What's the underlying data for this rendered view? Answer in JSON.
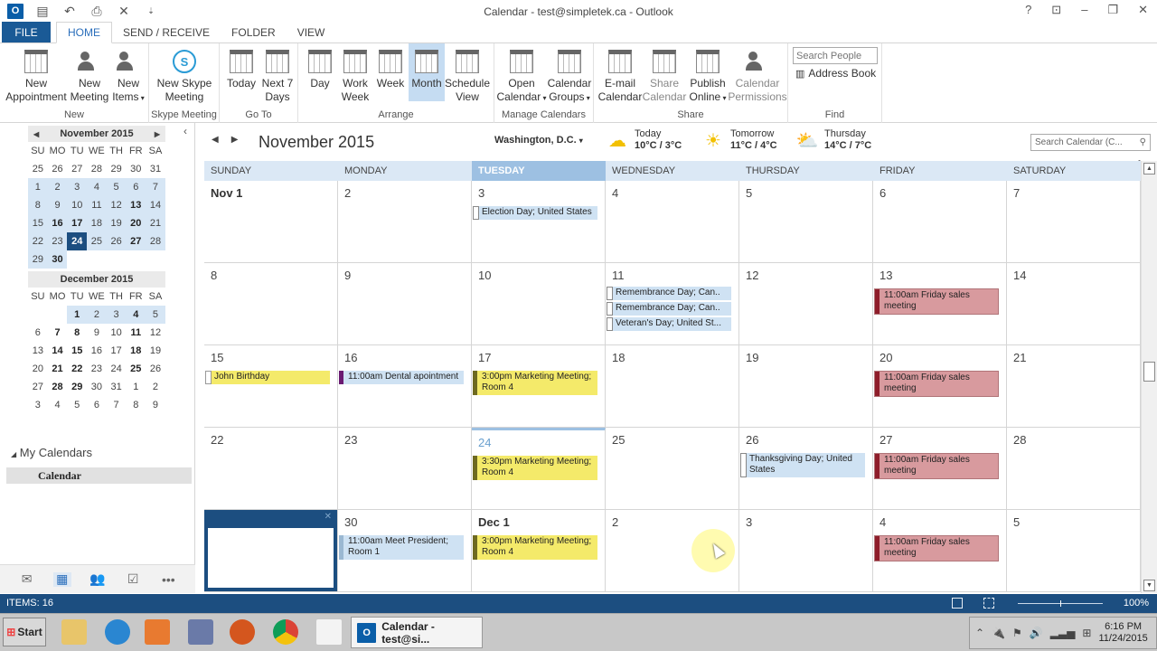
{
  "window": {
    "title": "Calendar - test@simpletek.ca - Outlook",
    "controls": [
      "?",
      "ribbon-display",
      "minimize",
      "restore",
      "close"
    ]
  },
  "qat": [
    "outlook-logo",
    "send-receive-icon",
    "undo-icon",
    "print-icon",
    "delete-icon",
    "customize-icon"
  ],
  "tabs": [
    {
      "label": "FILE"
    },
    {
      "label": "HOME",
      "active": true
    },
    {
      "label": "SEND / RECEIVE"
    },
    {
      "label": "FOLDER"
    },
    {
      "label": "VIEW"
    }
  ],
  "ribbon": {
    "groups": {
      "new": "New",
      "skype": "Skype Meeting",
      "goto": "Go To",
      "arrange": "Arrange",
      "manage": "Manage Calendars",
      "share": "Share",
      "find": "Find"
    },
    "buttons": {
      "new_appointment": [
        "New",
        "Appointment"
      ],
      "new_meeting": [
        "New",
        "Meeting"
      ],
      "new_items": [
        "New",
        "Items"
      ],
      "new_skype": [
        "New Skype",
        "Meeting"
      ],
      "today": [
        "Today",
        ""
      ],
      "next7": [
        "Next 7",
        "Days"
      ],
      "day": [
        "Day",
        ""
      ],
      "work_week": [
        "Work",
        "Week"
      ],
      "week": [
        "Week",
        ""
      ],
      "month": [
        "Month",
        ""
      ],
      "schedule": [
        "Schedule",
        "View"
      ],
      "open_calendar": [
        "Open",
        "Calendar"
      ],
      "calendar_groups": [
        "Calendar",
        "Groups"
      ],
      "email_calendar": [
        "E-mail",
        "Calendar"
      ],
      "share_calendar": [
        "Share",
        "Calendar"
      ],
      "publish_online": [
        "Publish",
        "Online"
      ],
      "calendar_permissions": [
        "Calendar",
        "Permissions"
      ]
    },
    "search_people_placeholder": "Search People",
    "address_book": "Address Book"
  },
  "sidebar": {
    "nov": {
      "title": "November 2015",
      "dow": [
        "SU",
        "MO",
        "TU",
        "WE",
        "TH",
        "FR",
        "SA"
      ],
      "days": [
        {
          "d": "25",
          "t": "other"
        },
        {
          "d": "26",
          "t": "other"
        },
        {
          "d": "27",
          "t": "other"
        },
        {
          "d": "28",
          "t": "other"
        },
        {
          "d": "29",
          "t": "other"
        },
        {
          "d": "30",
          "t": "other"
        },
        {
          "d": "31",
          "t": "other"
        },
        {
          "d": "1",
          "t": "cur"
        },
        {
          "d": "2",
          "t": "cur"
        },
        {
          "d": "3",
          "t": "cur"
        },
        {
          "d": "4",
          "t": "cur"
        },
        {
          "d": "5",
          "t": "cur"
        },
        {
          "d": "6",
          "t": "cur"
        },
        {
          "d": "7",
          "t": "cur"
        },
        {
          "d": "8",
          "t": "cur"
        },
        {
          "d": "9",
          "t": "cur"
        },
        {
          "d": "10",
          "t": "cur"
        },
        {
          "d": "11",
          "t": "cur"
        },
        {
          "d": "12",
          "t": "cur"
        },
        {
          "d": "13",
          "t": "cur b"
        },
        {
          "d": "14",
          "t": "cur"
        },
        {
          "d": "15",
          "t": "cur"
        },
        {
          "d": "16",
          "t": "cur b"
        },
        {
          "d": "17",
          "t": "cur b"
        },
        {
          "d": "18",
          "t": "cur"
        },
        {
          "d": "19",
          "t": "cur"
        },
        {
          "d": "20",
          "t": "cur b"
        },
        {
          "d": "21",
          "t": "cur"
        },
        {
          "d": "22",
          "t": "cur"
        },
        {
          "d": "23",
          "t": "cur"
        },
        {
          "d": "24",
          "t": "today"
        },
        {
          "d": "25",
          "t": "cur"
        },
        {
          "d": "26",
          "t": "cur"
        },
        {
          "d": "27",
          "t": "cur b"
        },
        {
          "d": "28",
          "t": "cur"
        },
        {
          "d": "29",
          "t": "cur"
        },
        {
          "d": "30",
          "t": "cur b"
        },
        {
          "d": "",
          "t": ""
        },
        {
          "d": "",
          "t": ""
        },
        {
          "d": "",
          "t": ""
        },
        {
          "d": "",
          "t": ""
        },
        {
          "d": "",
          "t": ""
        }
      ]
    },
    "dec": {
      "title": "December 2015",
      "dow": [
        "SU",
        "MO",
        "TU",
        "WE",
        "TH",
        "FR",
        "SA"
      ],
      "days": [
        {
          "d": "",
          "t": ""
        },
        {
          "d": "",
          "t": ""
        },
        {
          "d": "1",
          "t": "cur b"
        },
        {
          "d": "2",
          "t": "cur"
        },
        {
          "d": "3",
          "t": "cur"
        },
        {
          "d": "4",
          "t": "cur b"
        },
        {
          "d": "5",
          "t": "cur"
        },
        {
          "d": "6",
          "t": ""
        },
        {
          "d": "7",
          "t": "b"
        },
        {
          "d": "8",
          "t": "b"
        },
        {
          "d": "9",
          "t": ""
        },
        {
          "d": "10",
          "t": ""
        },
        {
          "d": "11",
          "t": "b"
        },
        {
          "d": "12",
          "t": ""
        },
        {
          "d": "13",
          "t": ""
        },
        {
          "d": "14",
          "t": "b"
        },
        {
          "d": "15",
          "t": "b"
        },
        {
          "d": "16",
          "t": ""
        },
        {
          "d": "17",
          "t": ""
        },
        {
          "d": "18",
          "t": "b"
        },
        {
          "d": "19",
          "t": ""
        },
        {
          "d": "20",
          "t": ""
        },
        {
          "d": "21",
          "t": "b"
        },
        {
          "d": "22",
          "t": "b"
        },
        {
          "d": "23",
          "t": ""
        },
        {
          "d": "24",
          "t": ""
        },
        {
          "d": "25",
          "t": "b"
        },
        {
          "d": "26",
          "t": ""
        },
        {
          "d": "27",
          "t": ""
        },
        {
          "d": "28",
          "t": "b"
        },
        {
          "d": "29",
          "t": "b"
        },
        {
          "d": "30",
          "t": ""
        },
        {
          "d": "31",
          "t": ""
        },
        {
          "d": "1",
          "t": "other"
        },
        {
          "d": "2",
          "t": "other"
        },
        {
          "d": "3",
          "t": "other"
        },
        {
          "d": "4",
          "t": "other"
        },
        {
          "d": "5",
          "t": "other"
        },
        {
          "d": "6",
          "t": "other"
        },
        {
          "d": "7",
          "t": "other"
        },
        {
          "d": "8",
          "t": "other"
        },
        {
          "d": "9",
          "t": "other"
        }
      ]
    },
    "my_calendars": "My Calendars",
    "calendar_item": "Calendar",
    "nav": [
      "mail",
      "calendar",
      "people",
      "tasks",
      "more"
    ]
  },
  "calendar": {
    "month_title": "November 2015",
    "location": "Washington, D.C.",
    "weather": [
      {
        "label": "Today",
        "temp": "10°C / 3°C",
        "icon": "partly-cloudy-night-icon"
      },
      {
        "label": "Tomorrow",
        "temp": "11°C / 4°C",
        "icon": "sunny-icon"
      },
      {
        "label": "Thursday",
        "temp": "14°C / 7°C",
        "icon": "partly-sunny-icon"
      }
    ],
    "search_placeholder": "Search Calendar (C...",
    "dow": [
      "SUNDAY",
      "MONDAY",
      "TUESDAY",
      "WEDNESDAY",
      "THURSDAY",
      "FRIDAY",
      "SATURDAY"
    ],
    "today_index": 2,
    "cells": [
      {
        "d": "Nov 1",
        "bold": true,
        "events": []
      },
      {
        "d": "2",
        "events": []
      },
      {
        "d": "3",
        "events": [
          {
            "text": "Election Day; United States",
            "style": "blue"
          }
        ]
      },
      {
        "d": "4",
        "events": []
      },
      {
        "d": "5",
        "events": []
      },
      {
        "d": "6",
        "events": []
      },
      {
        "d": "7",
        "events": []
      },
      {
        "d": "8",
        "events": []
      },
      {
        "d": "9",
        "events": []
      },
      {
        "d": "10",
        "events": []
      },
      {
        "d": "11",
        "events": [
          {
            "text": "Remembrance Day; Can..",
            "style": "blue single"
          },
          {
            "text": "Remembrance Day; Can..",
            "style": "blue single"
          },
          {
            "text": "Veteran's Day; United St...",
            "style": "blue single"
          }
        ]
      },
      {
        "d": "12",
        "events": []
      },
      {
        "d": "13",
        "events": [
          {
            "text": "11:00am Friday sales meeting",
            "style": "red"
          }
        ]
      },
      {
        "d": "14",
        "events": []
      },
      {
        "d": "15",
        "events": [
          {
            "text": "John Birthday",
            "style": "yellow"
          }
        ]
      },
      {
        "d": "16",
        "events": [
          {
            "text": "11:00am Dental apointment",
            "style": "purple"
          }
        ]
      },
      {
        "d": "17",
        "events": [
          {
            "text": "3:00pm Marketing Meeting; Room 4",
            "style": "yellowdark"
          }
        ]
      },
      {
        "d": "18",
        "events": []
      },
      {
        "d": "19",
        "events": []
      },
      {
        "d": "20",
        "events": [
          {
            "text": "11:00am Friday sales meeting",
            "style": "red"
          }
        ]
      },
      {
        "d": "21",
        "events": []
      },
      {
        "d": "22",
        "events": []
      },
      {
        "d": "23",
        "events": []
      },
      {
        "d": "24",
        "today": true,
        "events": [
          {
            "text": "3:30pm Marketing Meeting; Room 4",
            "style": "yellowdark"
          }
        ]
      },
      {
        "d": "25",
        "events": []
      },
      {
        "d": "26",
        "events": [
          {
            "text": "Thanksgiving Day; United States",
            "style": "blue"
          }
        ]
      },
      {
        "d": "27",
        "events": [
          {
            "text": "11:00am Friday sales meeting",
            "style": "red"
          }
        ]
      },
      {
        "d": "28",
        "events": []
      },
      {
        "d": "",
        "selected": true,
        "events": []
      },
      {
        "d": "30",
        "events": [
          {
            "text": "11:00am Meet President; Room 1",
            "style": "pres"
          }
        ]
      },
      {
        "d": "Dec 1",
        "bold": true,
        "events": [
          {
            "text": "3:00pm Marketing Meeting; Room 4",
            "style": "yellowdark"
          }
        ]
      },
      {
        "d": "2",
        "events": []
      },
      {
        "d": "3",
        "events": []
      },
      {
        "d": "4",
        "events": [
          {
            "text": "11:00am Friday sales meeting",
            "style": "red"
          }
        ]
      },
      {
        "d": "5",
        "events": []
      }
    ]
  },
  "status": {
    "items": "ITEMS: 16",
    "zoom_level": "100%",
    "zoom_fraction": 0.5
  },
  "taskbar": {
    "start": "Start",
    "task_label": "Calendar - test@si...",
    "time": "6:16 PM",
    "date": "11/24/2015"
  }
}
